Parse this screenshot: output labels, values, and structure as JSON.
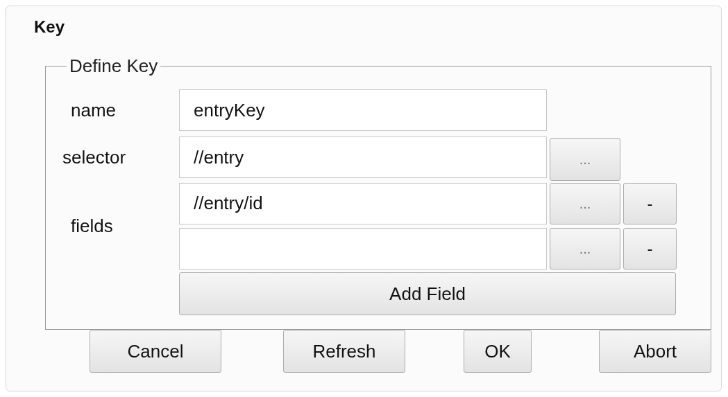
{
  "title": "Key",
  "group": {
    "legend": "Define Key",
    "name": {
      "label": "name",
      "value": "entryKey"
    },
    "selector": {
      "label": "selector",
      "value": "//entry",
      "browse": "..."
    },
    "fields": {
      "label": "fields",
      "rows": [
        {
          "value": "//entry/id",
          "browse": "...",
          "remove": "-"
        },
        {
          "value": "",
          "browse": "...",
          "remove": "-"
        }
      ],
      "add": "Add Field"
    }
  },
  "buttons": [
    "Cancel",
    "Refresh",
    "OK",
    "Abort"
  ]
}
